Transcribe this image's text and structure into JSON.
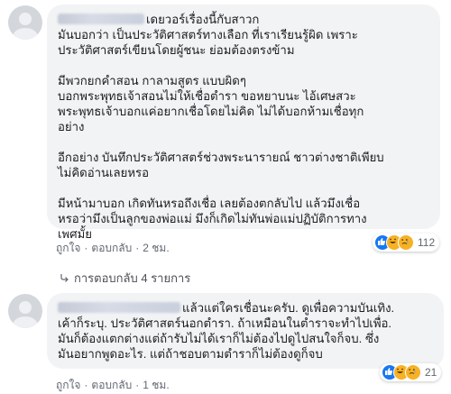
{
  "comments": [
    {
      "author_redacted": true,
      "first_line": "เดยวอร์เรื่องนี้กับสาวก",
      "paragraphs": [
        [
          "มันบอกว่า เป็นประวัติศาสตร์ทางเลือก ที่เราเรียนรู้ผิด เพราะ",
          "ประวัติศาสตร์เขียนโดยผู้ชนะ ย่อมต้องตรงข้าม"
        ],
        [
          "มีพวกยกคำสอน กาลามสูตร แบบผิดๆ",
          "บอกพระพุทธเจ้าสอนไม่ให้เชื่อตำรา ขอหยาบนะ ไอ้เศษสวะ",
          "พระพุทธเจ้าบอกแค่อยากเชื่อโดยไม่คิด ไม่ได้บอกห้ามเชื่อทุก",
          "อย่าง"
        ],
        [
          "อีกอย่าง บันทึกประวัติศาสตร์ช่วงพระนารายณ์ ชาวต่างชาติเพียบ",
          "ไม่คิดอ่านเลยหรอ"
        ],
        [
          "มีหน้ามาบอก เกิดทันหรอถึงเชื่อ เลยต้องตกลับไป แล้วมึงเชื่อ",
          "หรอว่ามึงเป็นลูกของพ่อแม่ มึงก็เกิดไม่ทันพ่อแม่ปฏิบัติการทาง",
          "เพศมั้ย"
        ]
      ],
      "actions": {
        "like": "ถูกใจ",
        "reply": "ตอบกลับ",
        "time": "2 ชม."
      },
      "reaction_count": "112",
      "replies_label": "การตอบกลับ 4 รายการ"
    },
    {
      "author_redacted": true,
      "first_line": "แล้วแต่ใครเชื่อนะครับ. ดูเพื่อความบันเทิง.",
      "lines": [
        "เค้าก็ระบุ. ประวัติศาสตร์นอกตำรา. ถ้าเหมือนในตำราจะทำไปเพื่อ.",
        "มันก็ต้องแตกต่างแต่ถ้ารับไม่ได้เราก็ไม่ต้องไปดูไปสนใจก็จบ. ซึ่ง",
        "มันอยากพูดอะไร. แต่ถ้าชอบตามตำราก็ไม่ต้องดูก็จบ"
      ],
      "actions": {
        "like": "ถูกใจ",
        "reply": "ตอบกลับ",
        "time": "1 ชม."
      },
      "reaction_count": "21"
    }
  ],
  "icons": {
    "reply_arrow": "reply-arrow-icon",
    "reactions": [
      "like-icon",
      "haha-icon",
      "sad-icon"
    ]
  },
  "colors": {
    "bubble_bg": "#f2f3f5",
    "like_blue": "#1877f2",
    "emoji_yellow": "#f7b125",
    "meta_gray": "#606770"
  }
}
